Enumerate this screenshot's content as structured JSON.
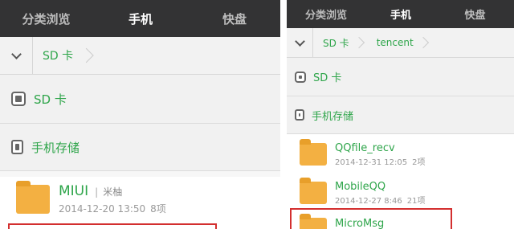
{
  "left": {
    "tabs": [
      "分类浏览",
      "手机",
      "快盘"
    ],
    "breadcrumb": [
      "SD 卡"
    ],
    "storage": [
      "SD 卡",
      "手机存储"
    ],
    "files": [
      {
        "name": "MIUI",
        "uploader": "米柚",
        "date": "2014-12-20 13:50",
        "count": "8项"
      }
    ]
  },
  "right": {
    "tabs": [
      "分类浏览",
      "手机",
      "快盘"
    ],
    "breadcrumb": [
      "SD 卡",
      "tencent"
    ],
    "storage": [
      "SD 卡",
      "手机存储"
    ],
    "files": [
      {
        "name": "QQfile_recv",
        "date": "2014-12-31 12:05",
        "count": "2项"
      },
      {
        "name": "MobileQQ",
        "date": "2014-12-27 8:46",
        "count": "21项"
      },
      {
        "name": "MicroMsg",
        "date": "",
        "count": ""
      }
    ]
  },
  "colors": {
    "accent": "#2ea54a",
    "nav_bg": "#333334",
    "highlight": "#d32f2f",
    "folder": "#f3b042"
  }
}
